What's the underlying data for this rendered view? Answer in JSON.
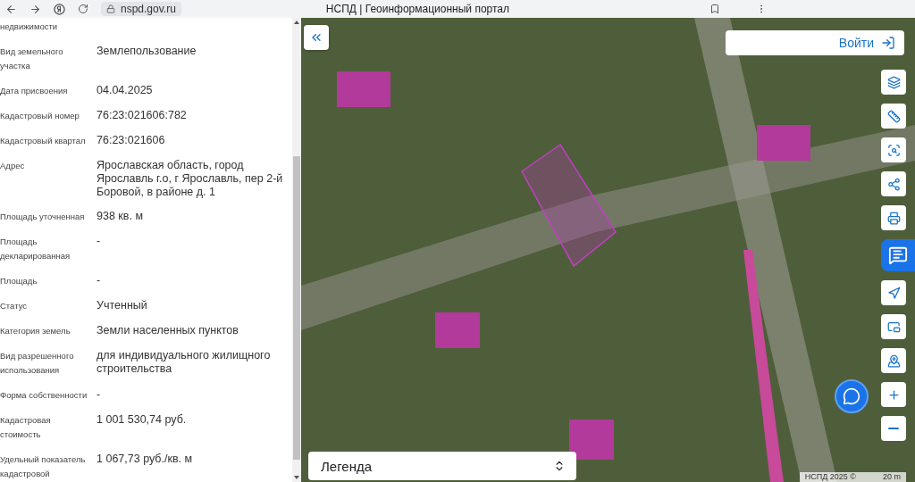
{
  "browser": {
    "url": "nspd.gov.ru",
    "tab_title": "НСПД | Геоинформационный портал"
  },
  "panel": {
    "rows": [
      {
        "label": "недвижимости"
      },
      {
        "label": "Вид земельного участка",
        "value": "Землепользование"
      },
      {
        "label": "Дата присвоения",
        "value": "04.04.2025"
      },
      {
        "label": "Кадастровый номер",
        "value": "76:23:021606:782"
      },
      {
        "label": "Кадастровый квартал",
        "value": "76:23:021606"
      },
      {
        "label": "Адрес",
        "value": "Ярославская область, город Ярославль г.о, г Ярославль, пер 2-й Боровой, в районе д. 1"
      },
      {
        "label": "Площадь уточненная",
        "value": "938 кв. м"
      },
      {
        "label": "Площадь декларированная",
        "value": "-"
      },
      {
        "label": "Площадь",
        "value": "-"
      },
      {
        "label": "Статус",
        "value": "Учтенный"
      },
      {
        "label": "Категория земель",
        "value": "Земли населенных пунктов"
      },
      {
        "label": "Вид разрешенного использования",
        "value": "для индивидуального жилищного строительства"
      },
      {
        "label": "Форма собственности",
        "value": "-"
      },
      {
        "label": "Кадастровая стоимость",
        "value": "1 001 530,74 руб."
      },
      {
        "label": "Удельный показатель кадастровой",
        "value": "1 067,73 руб./кв. м"
      }
    ]
  },
  "map": {
    "login_button": "Войти",
    "legend": "Легенда",
    "attribution": "НСПД 2025 ©",
    "scale": "20 m"
  }
}
